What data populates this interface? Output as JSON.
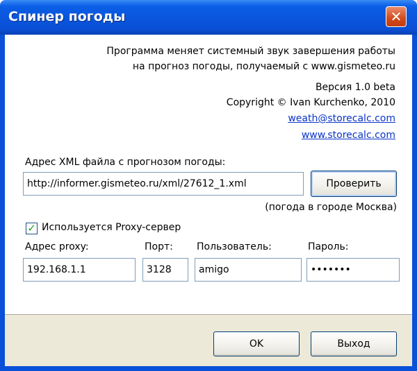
{
  "window": {
    "title": "Спинер погоды"
  },
  "about": {
    "description_line1": "Программа меняет системный звук завершения работы",
    "description_line2": "на прогноз погоды, получаемый с www.gismeteo.ru",
    "version": "Версия 1.0 beta",
    "copyright": "Copyright © Ivan Kurchenko, 2010",
    "email": "weath@storecalc.com",
    "website": "www.storecalc.com"
  },
  "xml": {
    "label": "Адрес XML файла с прогнозом погоды:",
    "value": "http://informer.gismeteo.ru/xml/27612_1.xml",
    "check_button": "Проверить",
    "city_note": "(погода в городе Москва)"
  },
  "proxy": {
    "checkbox_label": "Используется Proxy-сервер",
    "checked": true,
    "address_label": "Адрес proxy:",
    "address_value": "192.168.1.1",
    "port_label": "Порт:",
    "port_value": "3128",
    "user_label": "Пользователь:",
    "user_value": "amigo",
    "password_label": "Пароль:",
    "password_value": "•••••••"
  },
  "footer": {
    "ok_button": "OK",
    "exit_button": "Выход"
  }
}
